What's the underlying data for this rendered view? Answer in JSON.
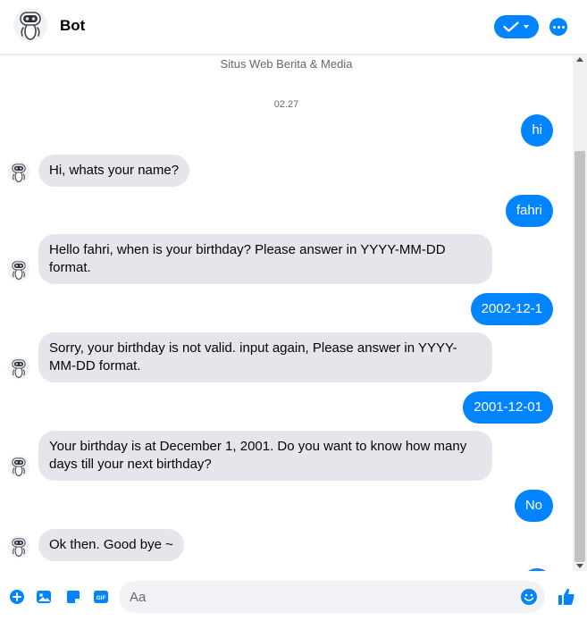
{
  "header": {
    "bot_name": "Bot"
  },
  "chat": {
    "page_subtitle": "Situs Web Berita & Media",
    "timestamp": "02.27",
    "messages": [
      {
        "from": "user",
        "text": "hi"
      },
      {
        "from": "bot",
        "text": "Hi, whats your name?"
      },
      {
        "from": "user",
        "text": "fahri"
      },
      {
        "from": "bot",
        "text": "Hello fahri, when is your birthday? Please answer in YYYY-MM-DD format."
      },
      {
        "from": "user",
        "text": "2002-12-1"
      },
      {
        "from": "bot",
        "text": "Sorry, your birthday is not valid. input again, Please answer in YYYY-MM-DD format."
      },
      {
        "from": "user",
        "text": "2001-12-01"
      },
      {
        "from": "bot",
        "text": "Your birthday is at December 1, 2001. Do you want to know how many days till your next birthday?"
      },
      {
        "from": "user",
        "text": "No"
      },
      {
        "from": "bot",
        "text": "Ok then. Good bye ~"
      }
    ]
  },
  "composer": {
    "placeholder": "Aa"
  },
  "colors": {
    "accent": "#0084ff",
    "incoming_bubble": "#e4e6eb"
  },
  "icons": [
    "check-icon",
    "dropdown-arrow-icon",
    "more-icon",
    "plus-icon",
    "photo-icon",
    "sticker-icon",
    "gif-icon",
    "emoji-icon",
    "thumbs-up-icon"
  ]
}
